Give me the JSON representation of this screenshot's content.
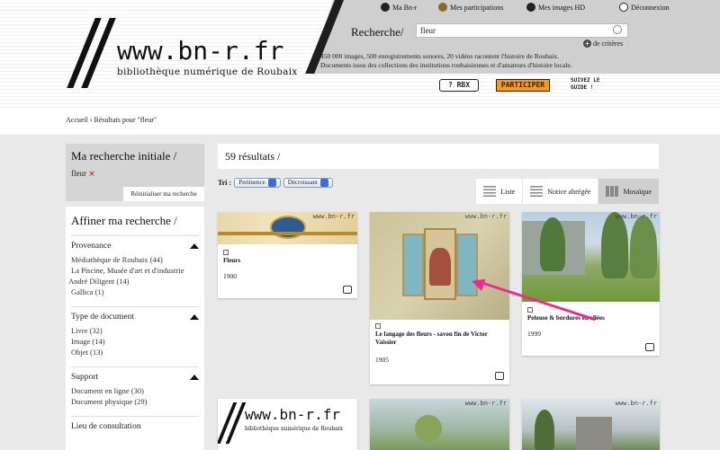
{
  "header": {
    "logo_url": "www.bn-r.fr",
    "logo_subtitle": "bibliothèque numérique de Roubaix",
    "nav": {
      "ma_bnr": "Ma Bn-r",
      "participations": "Mes participations",
      "images_hd": "Mes images HD",
      "deconnexion": "Déconnexion"
    },
    "search": {
      "label": "Recherche/",
      "value": "fleur",
      "criteria": "de critères"
    },
    "tagline_line1": "450 000 images, 500 enregistrements sonores, 20 vidéos racontent l'histoire de Roubaix.",
    "tagline_line2": "Documents issus des collections des institutions roubaisiennes et d'amateurs d'histoire locale.",
    "badges": {
      "rbx": "? RBX",
      "participer": "PARTICIPER",
      "guide": "SUIVEZ LE GUIDE !"
    }
  },
  "breadcrumb": "Accueil › Résultats pour \"fleur\"",
  "sidebar": {
    "initial_title": "Ma recherche initiale /",
    "initial_term": "fleur",
    "remove_symbol": "×",
    "reset": "Réinitialiser ma recherche",
    "affiner_title": "Affiner ma recherche /",
    "facets": [
      {
        "title": "Provenance",
        "items": [
          "Médiathèque de Roubaix (44)",
          "La Piscine, Musée d'art et d'industrie",
          "André Diligent (14)",
          "Gallica (1)"
        ]
      },
      {
        "title": "Type de document",
        "items": [
          "Livre (32)",
          "Image (14)",
          "Objet (13)"
        ]
      },
      {
        "title": "Support",
        "items": [
          "Document en ligne (30)",
          "Document physique (29)"
        ]
      },
      {
        "title": "Lieu de consultation",
        "items": []
      }
    ]
  },
  "main": {
    "results_count": "59 résultats /",
    "sort_label": "Tri :",
    "sort_field": "Pertinence",
    "sort_order": "Décroissant",
    "views": [
      "Liste",
      "Notice abrégée",
      "Mosaïque"
    ],
    "watermark": "www.bn-r.fr",
    "cards": [
      {
        "title": "Fleurs",
        "year": "1900"
      },
      {
        "title": "Le langage des fleurs - savon fin de Victor Vaissier",
        "year": "1905"
      },
      {
        "title": "Pelouse & bordures en allées",
        "year": "1999"
      }
    ],
    "bottom_card_logo": "www.bn-r.fr",
    "bottom_card_subtitle": "bibliothèque numérique de Roubaix"
  },
  "colors": {
    "accent_arrow": "#ee2b8d",
    "participer_badge": "#f39a1f"
  }
}
